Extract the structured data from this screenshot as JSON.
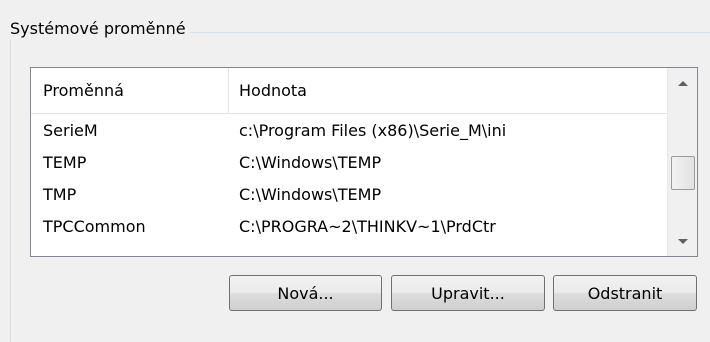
{
  "group": {
    "title": "Systémové proměnné"
  },
  "table": {
    "columns": [
      "Proměnná",
      "Hodnota"
    ],
    "rows": [
      {
        "name": "SerieM",
        "value": "c:\\Program Files (x86)\\Serie_M\\ini"
      },
      {
        "name": "TEMP",
        "value": "C:\\Windows\\TEMP"
      },
      {
        "name": "TMP",
        "value": "C:\\Windows\\TEMP"
      },
      {
        "name": "TPCCommon",
        "value": "C:\\PROGRA~2\\THINKV~1\\PrdCtr"
      }
    ]
  },
  "buttons": {
    "new": "Nová...",
    "edit": "Upravit...",
    "delete": "Odstranit"
  },
  "icons": {
    "scroll_up": "triangle-up-icon",
    "scroll_down": "triangle-down-icon"
  }
}
